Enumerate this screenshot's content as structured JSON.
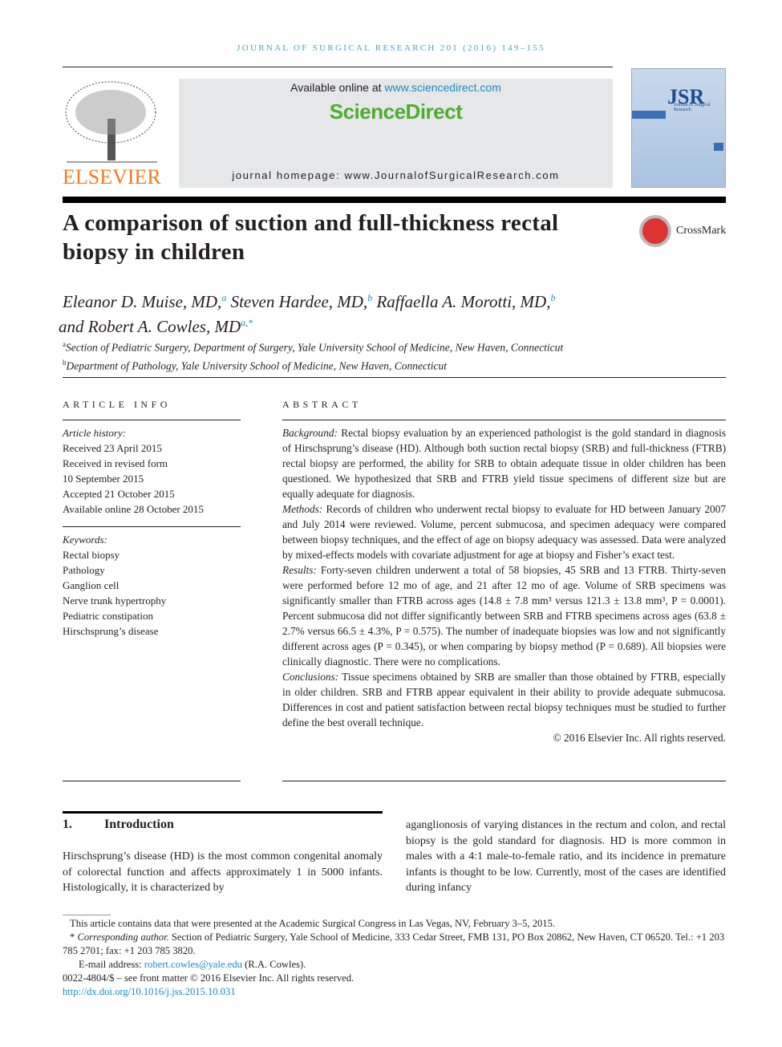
{
  "journal_header": "JOURNAL OF SURGICAL RESEARCH 201 (2016) 149–155",
  "publisher_logo": "ELSEVIER",
  "banner": {
    "available_prefix": "Available online at ",
    "available_link": "www.sciencedirect.com",
    "brand": "ScienceDirect",
    "homepage": "journal homepage: www.JournalofSurgicalResearch.com"
  },
  "cover": {
    "title": "JSR",
    "subtitle": "Journal of Surgical Research"
  },
  "crossmark": "CrossMark",
  "title": "A comparison of suction and full-thickness rectal biopsy in children",
  "authors": [
    {
      "name": "Eleanor D. Muise, MD,",
      "sup": "a"
    },
    {
      "name": " Steven Hardee, MD,",
      "sup": "b"
    },
    {
      "name": " Raffaella A. Morotti, MD,",
      "sup": "b"
    },
    {
      "name": " and Robert A. Cowles, MD",
      "sup": "a,*"
    }
  ],
  "affiliations": [
    {
      "sup": "a",
      "text": "Section of Pediatric Surgery, Department of Surgery, Yale University School of Medicine, New Haven, Connecticut"
    },
    {
      "sup": "b",
      "text": "Department of Pathology, Yale University School of Medicine, New Haven, Connecticut"
    }
  ],
  "article_info": {
    "heading": "ARTICLE INFO",
    "history_label": "Article history:",
    "history": [
      "Received 23 April 2015",
      "Received in revised form",
      "10 September 2015",
      "Accepted 21 October 2015",
      "Available online 28 October 2015"
    ],
    "keywords_label": "Keywords:",
    "keywords": [
      "Rectal biopsy",
      "Pathology",
      "Ganglion cell",
      "Nerve trunk hypertrophy",
      "Pediatric constipation",
      "Hirschsprung’s disease"
    ]
  },
  "abstract": {
    "heading": "ABSTRACT",
    "sections": [
      {
        "label": "Background:",
        "text": " Rectal biopsy evaluation by an experienced pathologist is the gold standard in diagnosis of Hirschsprung’s disease (HD). Although both suction rectal biopsy (SRB) and full-thickness (FTRB) rectal biopsy are performed, the ability for SRB to obtain adequate tissue in older children has been questioned. We hypothesized that SRB and FTRB yield tissue specimens of different size but are equally adequate for diagnosis."
      },
      {
        "label": "Methods:",
        "text": " Records of children who underwent rectal biopsy to evaluate for HD between January 2007 and July 2014 were reviewed. Volume, percent submucosa, and specimen adequacy were compared between biopsy techniques, and the effect of age on biopsy adequacy was assessed. Data were analyzed by mixed-effects models with covariate adjustment for age at biopsy and Fisher’s exact test."
      },
      {
        "label": "Results:",
        "text": " Forty-seven children underwent a total of 58 biopsies, 45 SRB and 13 FTRB. Thirty-seven were performed before 12 mo of age, and 21 after 12 mo of age. Volume of SRB specimens was significantly smaller than FTRB across ages (14.8 ± 7.8 mm³ versus 121.3 ± 13.8 mm³, P = 0.0001). Percent submucosa did not differ significantly between SRB and FTRB specimens across ages (63.8 ± 2.7% versus 66.5 ± 4.3%, P = 0.575). The number of inadequate biopsies was low and not significantly different across ages (P = 0.345), or when comparing by biopsy method (P = 0.689). All biopsies were clinically diagnostic. There were no complications."
      },
      {
        "label": "Conclusions:",
        "text": " Tissue specimens obtained by SRB are smaller than those obtained by FTRB, especially in older children. SRB and FTRB appear equivalent in their ability to provide adequate submucosa. Differences in cost and patient satisfaction between rectal biopsy techniques must be studied to further define the best overall technique."
      }
    ],
    "copyright": "© 2016 Elsevier Inc. All rights reserved."
  },
  "intro": {
    "number": "1.",
    "heading": "Introduction",
    "col1": "Hirschsprung’s disease (HD) is the most common congenital anomaly of colorectal function and affects approximately 1 in 5000 infants. Histologically, it is characterized by",
    "col2": "aganglionosis of varying distances in the rectum and colon, and rectal biopsy is the gold standard for diagnosis. HD is more common in males with a 4:1 male-to-female ratio, and its incidence in premature infants is thought to be low. Currently, most of the cases are identified during infancy"
  },
  "footnotes": {
    "presented": "This article contains data that were presented at the Academic Surgical Congress in Las Vegas, NV, February 3–5, 2015.",
    "corr_mark": "* ",
    "corr_label": "Corresponding author.",
    "corr_text": " Section of Pediatric Surgery, Yale School of Medicine, 333 Cedar Street, FMB 131, PO Box 20862, New Haven, CT 06520. Tel.: +1 203 785 2701; fax: +1 203 785 3820.",
    "email_label": "E-mail address: ",
    "email": "robert.cowles@yale.edu",
    "email_suffix": " (R.A. Cowles).",
    "issn": "0022-4804/$ – see front matter © 2016 Elsevier Inc. All rights reserved.",
    "doi": "http://dx.doi.org/10.1016/j.jss.2015.10.031"
  }
}
